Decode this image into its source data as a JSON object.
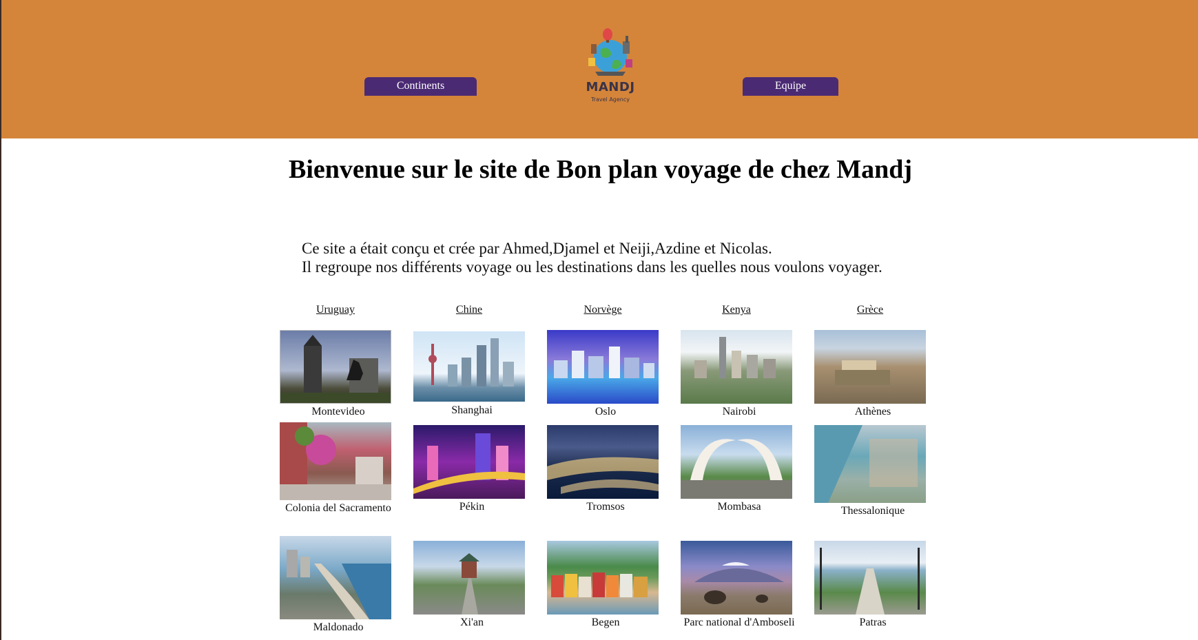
{
  "header": {
    "nav_left": "Continents",
    "nav_right": "Equipe",
    "logo_name": "MANDJ",
    "logo_tagline": "Travel Agency",
    "background": "#d4853a",
    "button_color": "#4b2a74"
  },
  "main": {
    "title": "Bienvenue sur le site de Bon plan voyage de chez Mandj",
    "intro_line1": "Ce site a était conçu et crée par Ahmed,Djamel et Neiji,Azdine et Nicolas.",
    "intro_line2": "Il regroupe nos différents voyage ou les destinations dans les quelles nous voulons voyager."
  },
  "countries": [
    {
      "name": "Uruguay",
      "cities": [
        "Montevideo",
        "Colonia del Sacramento",
        "Maldonado"
      ]
    },
    {
      "name": "Chine",
      "cities": [
        "Shanghai",
        "Pékin",
        "Xi'an"
      ]
    },
    {
      "name": "Norvège",
      "cities": [
        "Oslo",
        "Tromsos",
        "Begen"
      ]
    },
    {
      "name": "Kenya",
      "cities": [
        "Nairobi",
        "Mombasa",
        "Parc national d'Amboseli"
      ]
    },
    {
      "name": "Grèce",
      "cities": [
        "Athènes",
        "Thessalonique",
        "Patras"
      ]
    }
  ]
}
